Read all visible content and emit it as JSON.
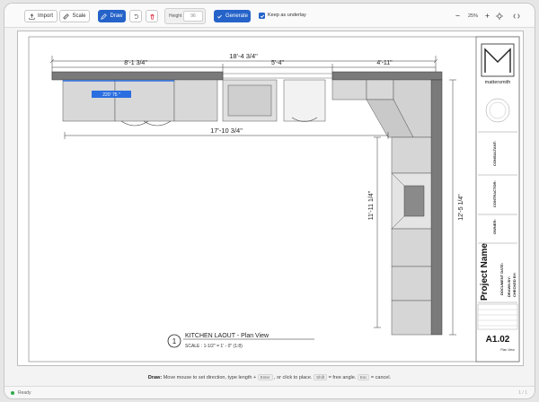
{
  "toolbar": {
    "import_label": "Import",
    "scale_label": "Scale",
    "draw_label": "Draw",
    "height_label": "Height",
    "height_value": "96",
    "generate_label": "Generate",
    "keep_underlay_label": "Keep as underlay",
    "zoom_level": "25%"
  },
  "drawing": {
    "dim_total_top": "18'-4 3/4\"",
    "dim_left": "8'-1 3/4\"",
    "dim_mid": "5'-4\"",
    "dim_right": "4'-11\"",
    "dim_base": "17'-10 3/4\"",
    "dim_vert_inner": "11'-11 1/4\"",
    "dim_vert_outer": "12'-5 1/4\"",
    "cursor_input": "220' 75 \"",
    "view_number": "1",
    "view_title": "KITCHEN LAOUT - Plan View",
    "view_scale": "SCALE  :  1-1/2\" = 1' - 0\" (1:8)"
  },
  "title_block": {
    "brand": "mattersmith",
    "project_name": "Project Name",
    "sheet_number": "A1.02",
    "sheet_sub": "Plan View",
    "consultant": "CONSULTANT:",
    "contractor": "CONTRACTOR:",
    "owner": "OWNER:",
    "document_date": "DOCUMENT DATE:",
    "drawn_by": "DRAWN BY:",
    "checked_by": "CHECKED BY:"
  },
  "status": {
    "mode": "Draw:",
    "text1": "Move mouse to set direction, type length +",
    "key1": "Enter",
    "text2": ", or click to place.",
    "key2": "Shift",
    "text3": "= free angle.",
    "key3": "Esc",
    "text4": "= cancel."
  },
  "footer": {
    "ready": "Ready",
    "page": "1 / 1"
  }
}
